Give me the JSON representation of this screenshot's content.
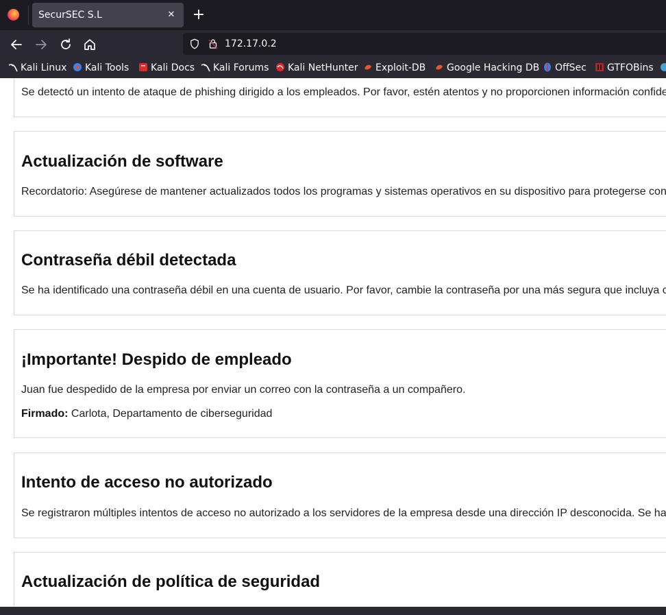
{
  "browser": {
    "tab_title": "SecurSEC S.L",
    "tab_close": "✕",
    "new_tab": "+",
    "url": "172.17.0.2",
    "bookmarks": [
      {
        "label": "Kali Linux",
        "icon": "kali-dragon-icon",
        "color": "#ffffff"
      },
      {
        "label": "Kali Tools",
        "icon": "kali-tools-icon",
        "color": "#3b82f6"
      },
      {
        "label": "Kali Docs",
        "icon": "kali-docs-icon",
        "color": "#d92d2d"
      },
      {
        "label": "Kali Forums",
        "icon": "kali-dragon-icon",
        "color": "#ffffff"
      },
      {
        "label": "Kali NetHunter",
        "icon": "nethunter-icon",
        "color": "#d92d2d"
      },
      {
        "label": "Exploit-DB",
        "icon": "exploit-db-icon",
        "color": "#e2572b"
      },
      {
        "label": "Google Hacking DB",
        "icon": "ghdb-icon",
        "color": "#e2572b"
      },
      {
        "label": "OffSec",
        "icon": "offsec-icon",
        "color": "#4a7bd8"
      },
      {
        "label": "GTFOBins",
        "icon": "gtfobins-icon",
        "color": "#b0281f"
      }
    ]
  },
  "notices": [
    {
      "title": "",
      "text": "Se detectó un intento de ataque de phishing dirigido a los empleados. Por favor, estén atentos y no proporcionen información confidencial."
    },
    {
      "title": "Actualización de software",
      "text": "Recordatorio: Asegúrese de mantener actualizados todos los programas y sistemas operativos en su dispositivo para protegerse contra vulnerabilidades."
    },
    {
      "title": "Contraseña débil detectada",
      "text": "Se ha identificado una contraseña débil en una cuenta de usuario. Por favor, cambie la contraseña por una más segura que incluya caracteres especiales."
    },
    {
      "title": "¡Importante! Despido de empleado",
      "text": "Juan fue despedido de la empresa por enviar un correo con la contraseña a un compañero.",
      "signed_label": "Firmado:",
      "signed_value": "Carlota, Departamento de ciberseguridad"
    },
    {
      "title": "Intento de acceso no autorizado",
      "text": "Se registraron múltiples intentos de acceso no autorizado a los servidores de la empresa desde una dirección IP desconocida. Se han tomado medidas."
    },
    {
      "title": "Actualización de política de seguridad",
      "text": ""
    }
  ]
}
